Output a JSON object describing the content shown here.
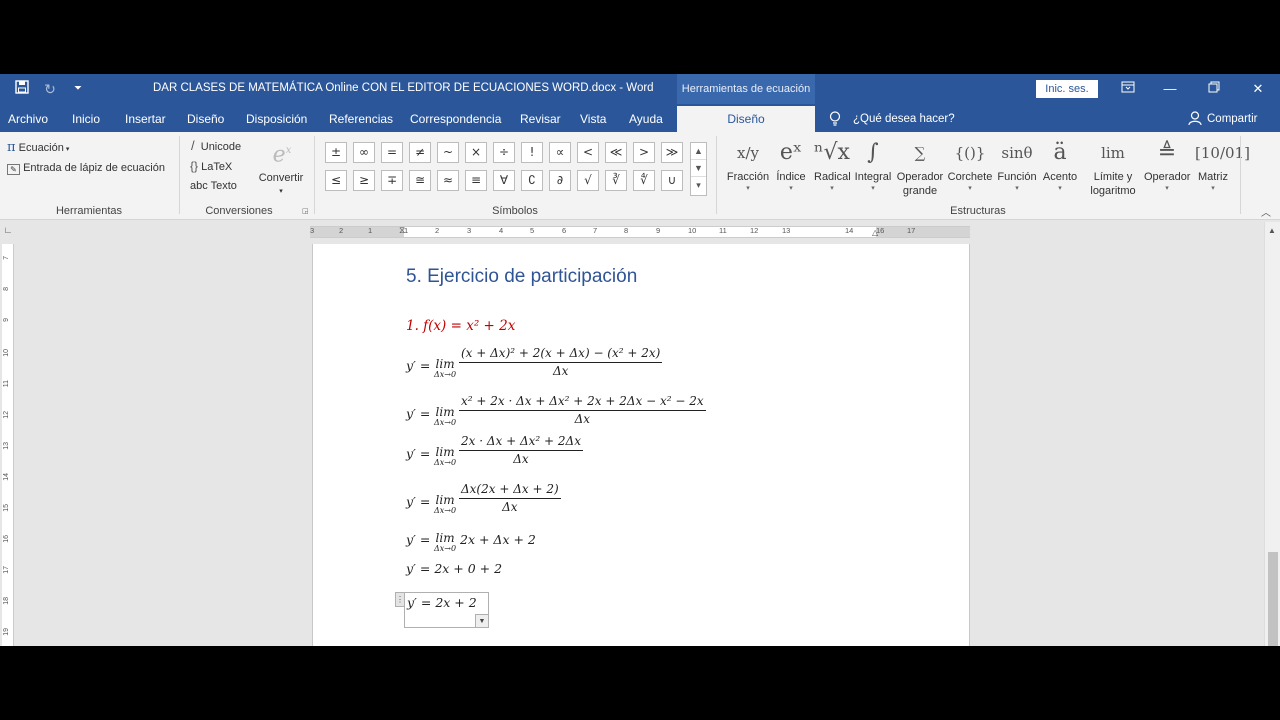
{
  "window": {
    "doc_title": "DAR CLASES DE MATEMÁTICA Online CON EL EDITOR DE ECUACIONES WORD.docx  -  Word",
    "context_tab": "Herramientas de ecuación",
    "signin": "Inic. ses."
  },
  "tabs": [
    "Archivo",
    "Inicio",
    "Insertar",
    "Diseño",
    "Disposición",
    "Referencias",
    "Correspondencia",
    "Revisar",
    "Vista",
    "Ayuda"
  ],
  "active_tab": "Diseño",
  "tellme": "¿Qué desea hacer?",
  "share": "Compartir",
  "ribbon": {
    "herramientas": {
      "ecuacion": "Ecuación",
      "lapiz": "Entrada de lápiz de ecuación",
      "label": "Herramientas"
    },
    "conversiones": {
      "unicode": "Unicode",
      "latex": "LaTeX",
      "texto": "abc Texto",
      "convertir": "Convertir",
      "label": "Conversiones"
    },
    "simbolos": {
      "row1": [
        "±",
        "∞",
        "=",
        "≠",
        "~",
        "×",
        "÷",
        "!",
        "∝",
        "<",
        "≪",
        ">",
        "≫"
      ],
      "row2": [
        "≤",
        "≥",
        "∓",
        "≅",
        "≈",
        "≡",
        "∀",
        "∁",
        "∂",
        "√",
        "∛",
        "∜",
        "∪"
      ],
      "label": "Símbolos"
    },
    "estructuras": {
      "items": [
        {
          "icon": "x/y",
          "label": "Fracción",
          "label2": ""
        },
        {
          "icon": "eˣ",
          "label": "Índice",
          "label2": ""
        },
        {
          "icon": "ⁿ√x",
          "label": "Radical",
          "label2": ""
        },
        {
          "icon": "∫",
          "label": "Integral",
          "label2": ""
        },
        {
          "icon": "∑",
          "label": "Operador",
          "label2": "grande"
        },
        {
          "icon": "{()}",
          "label": "Corchete",
          "label2": ""
        },
        {
          "icon": "sinθ",
          "label": "Función",
          "label2": ""
        },
        {
          "icon": "ä",
          "label": "Acento",
          "label2": ""
        },
        {
          "icon": "lim",
          "label": "Límite y",
          "label2": "logaritmo"
        },
        {
          "icon": "≜",
          "label": "Operador",
          "label2": ""
        },
        {
          "icon": "[10/01]",
          "label": "Matriz",
          "label2": ""
        }
      ],
      "label": "Estructuras"
    }
  },
  "document": {
    "heading": "5. Ejercicio de participación",
    "eq1": "1. f(x) = x² + 2x",
    "prefix": "y′ =",
    "lim_word": "lim",
    "lim_sub": "Δx→0",
    "lines": [
      {
        "num": "(x + Δx)² + 2(x + Δx) − (x² + 2x)",
        "den": "Δx"
      },
      {
        "num": "x² + 2x · Δx + Δx² + 2x + 2Δx − x² − 2x",
        "den": "Δx"
      },
      {
        "num": "2x · Δx + Δx² + 2Δx",
        "den": "Δx"
      },
      {
        "num": "Δx(2x + Δx + 2)",
        "den": "Δx"
      }
    ],
    "line5": "2x + Δx + 2",
    "line6": "y′ = 2x + 0 + 2",
    "line7": "y′ = 2x + 2"
  },
  "ruler_numbers": [
    "3",
    "2",
    "1",
    "1",
    "2",
    "3",
    "4",
    "5",
    "6",
    "7",
    "8",
    "9",
    "10",
    "11",
    "12",
    "13",
    "14",
    "16",
    "17"
  ],
  "vruler_numbers": [
    "7",
    "8",
    "9",
    "10",
    "11",
    "12",
    "13",
    "14",
    "15",
    "16",
    "17",
    "18",
    "19"
  ]
}
